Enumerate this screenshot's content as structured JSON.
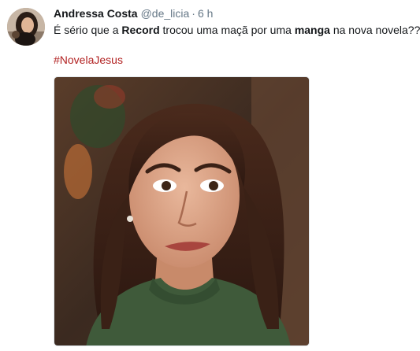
{
  "tweet": {
    "author": {
      "name": "Andressa Costa",
      "handle": "@de_licia",
      "separator": "·",
      "time": "6 h"
    },
    "text": {
      "part1": "É sério que a ",
      "bold1": "Record",
      "part2": " trocou uma maçã por uma ",
      "bold2": "manga",
      "part3": " na nova novela??"
    },
    "hashtag": "#NovelaJesus",
    "colors": {
      "hashtag": "#b22222",
      "secondary_text": "#657786",
      "primary_text": "#14171a"
    }
  }
}
